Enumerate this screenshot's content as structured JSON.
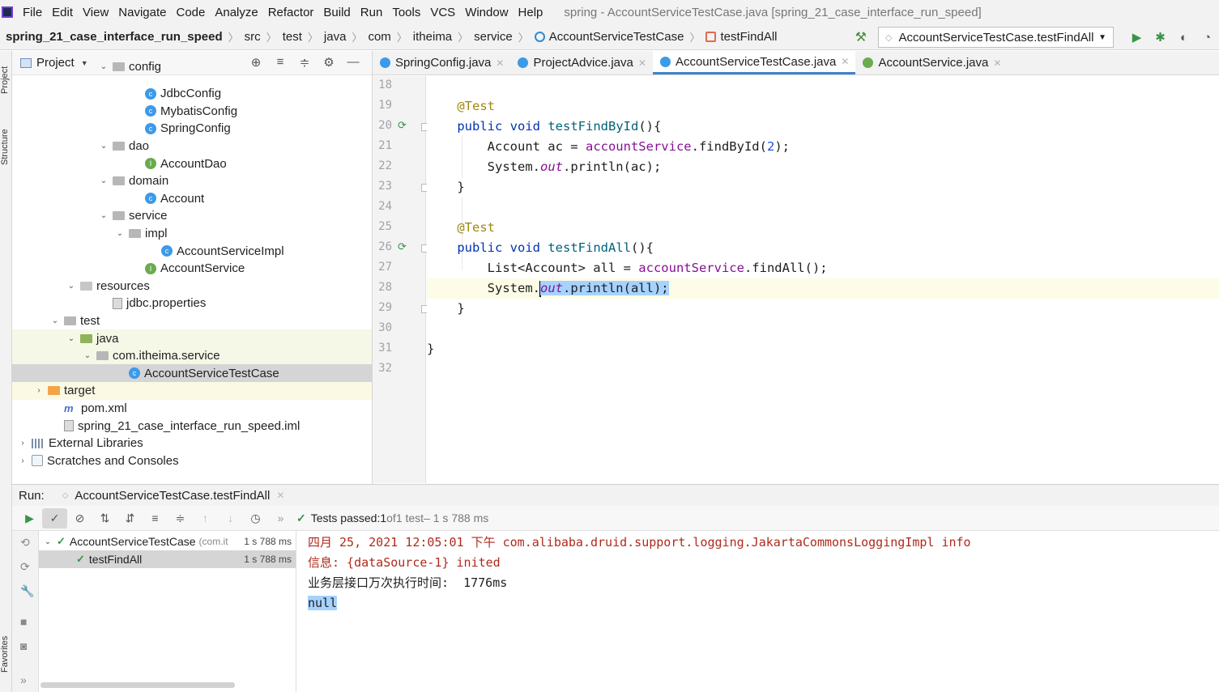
{
  "menu": [
    "File",
    "Edit",
    "View",
    "Navigate",
    "Code",
    "Analyze",
    "Refactor",
    "Build",
    "Run",
    "Tools",
    "VCS",
    "Window",
    "Help"
  ],
  "window_title": "spring - AccountServiceTestCase.java [spring_21_case_interface_run_speed]",
  "breadcrumbs": [
    "spring_21_case_interface_run_speed",
    "src",
    "test",
    "java",
    "com",
    "itheima",
    "service",
    "AccountServiceTestCase",
    "testFindAll"
  ],
  "run_config": "AccountServiceTestCase.testFindAll",
  "left_strip": {
    "project": "Project",
    "structure": "Structure",
    "favorites": "Favorites"
  },
  "project_panel": {
    "title": "Project",
    "tree": [
      {
        "label": "config",
        "depth": 5,
        "type": "folder",
        "expanded": true,
        "partial": true
      },
      {
        "label": "JdbcConfig",
        "depth": 7,
        "type": "class"
      },
      {
        "label": "MybatisConfig",
        "depth": 7,
        "type": "class"
      },
      {
        "label": "SpringConfig",
        "depth": 7,
        "type": "class"
      },
      {
        "label": "dao",
        "depth": 5,
        "type": "folder",
        "expanded": true
      },
      {
        "label": "AccountDao",
        "depth": 7,
        "type": "interface"
      },
      {
        "label": "domain",
        "depth": 5,
        "type": "folder",
        "expanded": true
      },
      {
        "label": "Account",
        "depth": 7,
        "type": "class"
      },
      {
        "label": "service",
        "depth": 5,
        "type": "folder",
        "expanded": true
      },
      {
        "label": "impl",
        "depth": 6,
        "type": "folder",
        "expanded": true
      },
      {
        "label": "AccountServiceImpl",
        "depth": 8,
        "type": "class"
      },
      {
        "label": "AccountService",
        "depth": 7,
        "type": "interface"
      },
      {
        "label": "resources",
        "depth": 3,
        "type": "res-folder",
        "expanded": true
      },
      {
        "label": "jdbc.properties",
        "depth": 5,
        "type": "file"
      },
      {
        "label": "test",
        "depth": 2,
        "type": "folder",
        "expanded": true
      },
      {
        "label": "java",
        "depth": 3,
        "type": "green-folder",
        "expanded": true,
        "highlight": true
      },
      {
        "label": "com.itheima.service",
        "depth": 4,
        "type": "folder",
        "expanded": true,
        "highlight": true
      },
      {
        "label": "AccountServiceTestCase",
        "depth": 6,
        "type": "class",
        "selected": true
      },
      {
        "label": "target",
        "depth": 1,
        "type": "orange-folder",
        "expanded": false,
        "warn": true
      },
      {
        "label": "pom.xml",
        "depth": 2,
        "type": "maven"
      },
      {
        "label": "spring_21_case_interface_run_speed.iml",
        "depth": 2,
        "type": "file"
      },
      {
        "label": "External Libraries",
        "depth": 0,
        "type": "lib",
        "expanded": false
      },
      {
        "label": "Scratches and Consoles",
        "depth": 0,
        "type": "scratch",
        "expanded": false
      }
    ]
  },
  "editor": {
    "tabs": [
      {
        "label": "SpringConfig.java",
        "kind": "class",
        "active": false
      },
      {
        "label": "ProjectAdvice.java",
        "kind": "class",
        "active": false
      },
      {
        "label": "AccountServiceTestCase.java",
        "kind": "class",
        "active": true
      },
      {
        "label": "AccountService.java",
        "kind": "interface",
        "active": false
      }
    ],
    "line_numbers": [
      "18",
      "19",
      "20",
      "21",
      "22",
      "23",
      "24",
      "25",
      "26",
      "27",
      "28",
      "29",
      "30",
      "31",
      "32"
    ],
    "code": {
      "l19_ann": "@Test",
      "l20_kw": "public void",
      "l20_method": "testFindById",
      "l20_rest": "(){",
      "l21_a": "Account ac = ",
      "l21_field": "accountService",
      "l21_b": ".findById(",
      "l21_num": "2",
      "l21_c": ");",
      "l22_a": "System.",
      "l22_out": "out",
      "l22_b": ".println(ac);",
      "l23": "}",
      "l25_ann": "@Test",
      "l26_kw": "public void",
      "l26_method": "testFindAll",
      "l26_rest": "(){",
      "l27_a": "List<Account> all = ",
      "l27_field": "accountService",
      "l27_b": ".findAll();",
      "l28_a": "System.",
      "l28_out": "out",
      "l28_b": ".println(all);",
      "l29": "}",
      "l31": "}"
    }
  },
  "run": {
    "label": "Run:",
    "tab": "AccountServiceTestCase.testFindAll",
    "status": {
      "prefix": "Tests passed: ",
      "passed": "1",
      "of": " of ",
      "total": "1 test",
      "duration": " – 1 s 788 ms"
    },
    "tests": [
      {
        "name": "AccountServiceTestCase",
        "meta": "(com.it",
        "time": "1 s 788 ms"
      },
      {
        "name": "testFindAll",
        "meta": "",
        "time": "1 s 788 ms"
      }
    ],
    "console": [
      "四月 25, 2021 12:05:01 下午 com.alibaba.druid.support.logging.JakartaCommonsLoggingImpl info",
      "信息: {dataSource-1} inited",
      "业务层接口万次执行时间:  1776ms",
      "null"
    ]
  }
}
